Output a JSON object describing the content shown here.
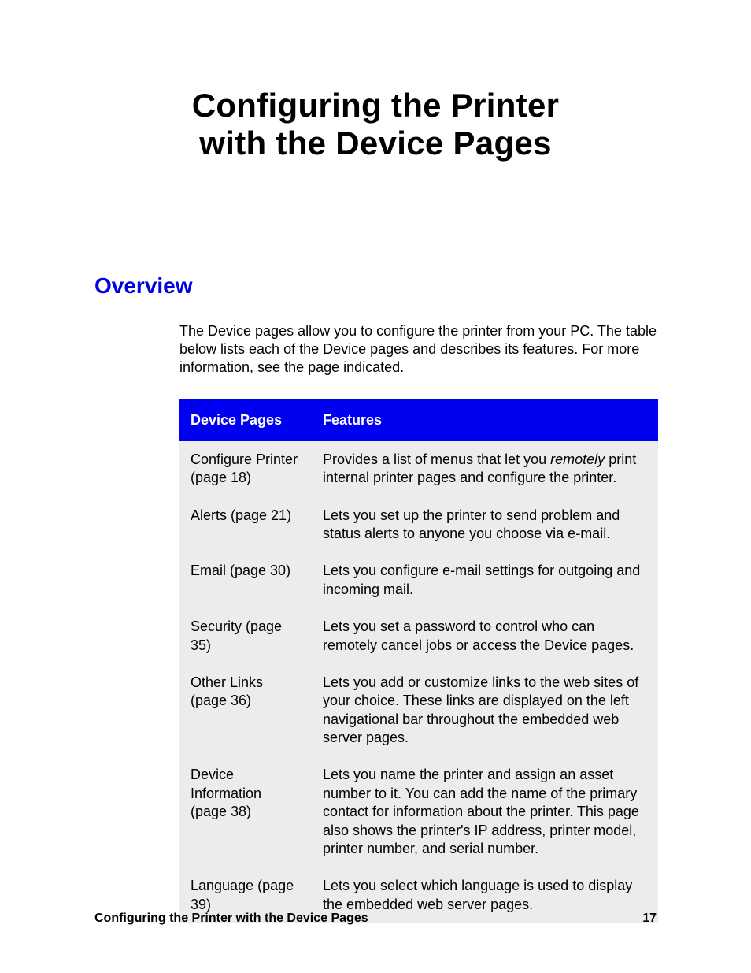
{
  "title_line1": "Configuring the Printer",
  "title_line2": "with the Device Pages",
  "overview_heading": "Overview",
  "intro": "The Device pages allow you to configure the printer from your PC. The table below lists each of the Device pages and describes its features. For more information, see the page indicated.",
  "table": {
    "header_col1": "Device Pages",
    "header_col2": "Features",
    "rows": [
      {
        "name": "Configure Printer (page 18)",
        "feature_pre": "Provides a list of menus that let you ",
        "feature_em": "remotely",
        "feature_post": " print internal printer pages and configure the printer."
      },
      {
        "name": "Alerts (page 21)",
        "feature": "Lets you set up the printer to send problem and status alerts to anyone you choose via e-mail."
      },
      {
        "name": "Email (page 30)",
        "feature": "Lets you configure e-mail settings for outgoing and incoming mail."
      },
      {
        "name": "Security (page 35)",
        "feature": "Lets you set a password to control who can remotely cancel jobs or access the Device pages."
      },
      {
        "name": "Other Links (page 36)",
        "feature": "Lets you add or customize links to the web sites of your choice. These links are displayed on the left navigational bar throughout the embedded web server pages."
      },
      {
        "name": "Device Information (page 38)",
        "feature": "Lets you name the printer and assign an asset number to it. You can add the name of the primary contact for information about the printer. This page also shows the printer's IP address, printer model, printer number, and serial number."
      },
      {
        "name": "Language (page 39)",
        "feature": "Lets you select which language is used to display the embedded web server pages."
      }
    ]
  },
  "footer_title": "Configuring the Printer with the Device Pages",
  "footer_page": "17"
}
